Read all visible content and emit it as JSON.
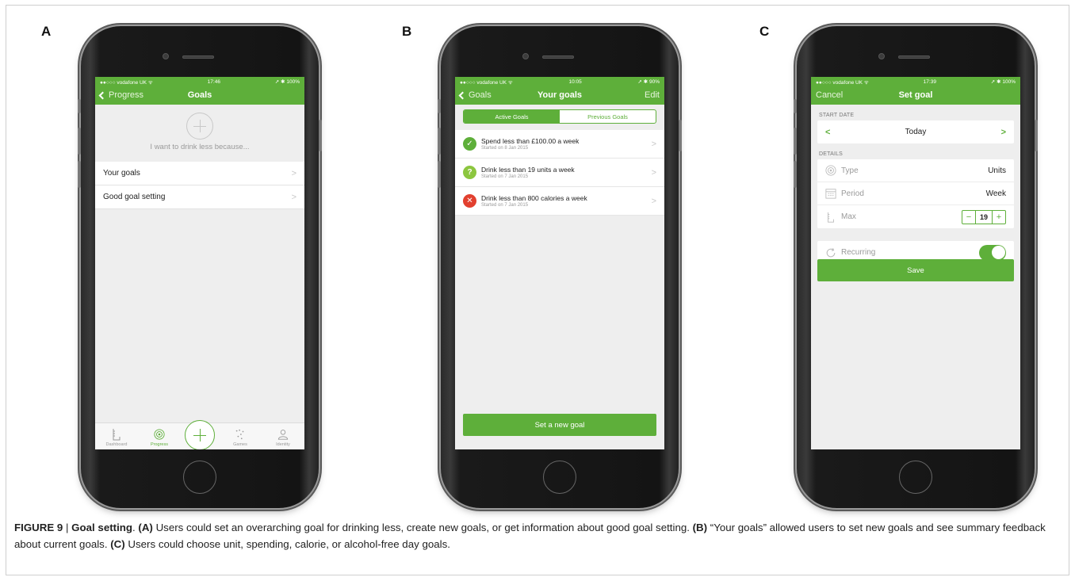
{
  "panels": {
    "a": {
      "letter": "A",
      "status": {
        "carrier": "●●○○○ vodafone UK ᯤ",
        "time": "17:46",
        "battery": "➚ ✱ 100%"
      },
      "nav": {
        "back": "Progress",
        "title": "Goals"
      },
      "motivation": "I want to drink less because...",
      "rows": [
        "Your goals",
        "Good goal setting"
      ],
      "tabs": [
        "Dashboard",
        "Progress",
        "Games",
        "Identity"
      ]
    },
    "b": {
      "letter": "B",
      "status": {
        "carrier": "●●○○○ vodafone UK ᯤ",
        "time": "10:05",
        "battery": "➚ ✱ 90%"
      },
      "nav": {
        "back": "Goals",
        "title": "Your goals",
        "right": "Edit"
      },
      "segments": [
        "Active Goals",
        "Previous Goals"
      ],
      "goals": [
        {
          "title": "Spend less than £100.00 a week",
          "started": "Started on 8 Jan 2015",
          "status": "✓",
          "color": "#5eaf3a"
        },
        {
          "title": "Drink less than 19 units a week",
          "started": "Started on 7 Jan 2015",
          "status": "?",
          "color": "#8cc63f"
        },
        {
          "title": "Drink less than 800 calories a week",
          "started": "Started on 7 Jan 2015",
          "status": "✕",
          "color": "#e2402f"
        }
      ],
      "button": "Set a new goal"
    },
    "c": {
      "letter": "C",
      "status": {
        "carrier": "●●○○○ vodafone UK ᯤ",
        "time": "17:39",
        "battery": "➚ ✱ 100%"
      },
      "nav": {
        "left": "Cancel",
        "title": "Set goal"
      },
      "start_date_header": "START DATE",
      "start_date_value": "Today",
      "details_header": "DETAILS",
      "details": [
        {
          "label": "Type",
          "value": "Units",
          "icon": "target-icon"
        },
        {
          "label": "Period",
          "value": "Week",
          "icon": "calendar-icon"
        },
        {
          "label": "Max",
          "value": "19",
          "icon": "ruler-icon"
        }
      ],
      "stepper": {
        "minus": "−",
        "plus": "+"
      },
      "recurring_label": "Recurring",
      "save_button": "Save"
    }
  },
  "caption": {
    "figure": "FIGURE 9",
    "sep": " | ",
    "title": "Goal setting",
    "a_label": "(A)",
    "a_text": " Users could set an overarching goal for drinking less, create new goals, or get information about good goal setting. ",
    "b_label": "(B)",
    "b_text": " “Your goals” allowed users to set new goals and see summary feedback about current goals. ",
    "c_label": "(C)",
    "c_text": " Users could choose unit, spending, calorie, or alcohol-free day goals."
  }
}
